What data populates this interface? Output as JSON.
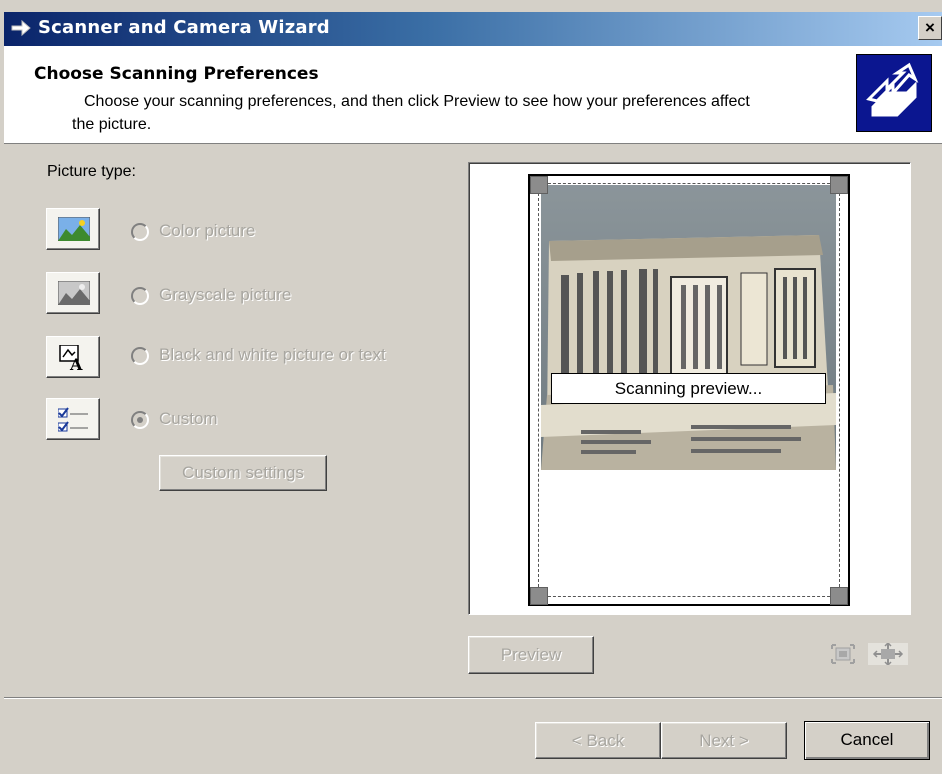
{
  "window": {
    "title": "Scanner and Camera Wizard",
    "close_label": "×"
  },
  "header": {
    "title": "Choose Scanning Preferences",
    "subtitle_line1": "Choose your scanning preferences, and then click Preview to see how your preferences affect",
    "subtitle_line2": "the picture.",
    "logo_icon": "scanner-wizard-icon"
  },
  "picture_type": {
    "label": "Picture type:",
    "options": [
      {
        "label": "Color picture",
        "icon": "color-picture-icon",
        "selected": false
      },
      {
        "label": "Grayscale picture",
        "icon": "grayscale-picture-icon",
        "selected": false
      },
      {
        "label": "Black and white picture or text",
        "icon": "bw-text-icon",
        "selected": false
      },
      {
        "label": "Custom",
        "icon": "custom-settings-icon",
        "selected": true
      }
    ],
    "custom_settings_label": "Custom settings"
  },
  "preview": {
    "status": "Scanning preview...",
    "preview_button": "Preview",
    "zoom_in_icon": "zoom-fit-icon",
    "zoom_out_icon": "zoom-selection-icon"
  },
  "footer": {
    "back_label": "< Back",
    "next_label": "Next >",
    "cancel_label": "Cancel"
  },
  "colors": {
    "dialog_bg": "#d4d0c8",
    "titlebar_start": "#0a246a",
    "titlebar_end": "#a6caf0",
    "disabled_text": "#a8a6a0"
  }
}
